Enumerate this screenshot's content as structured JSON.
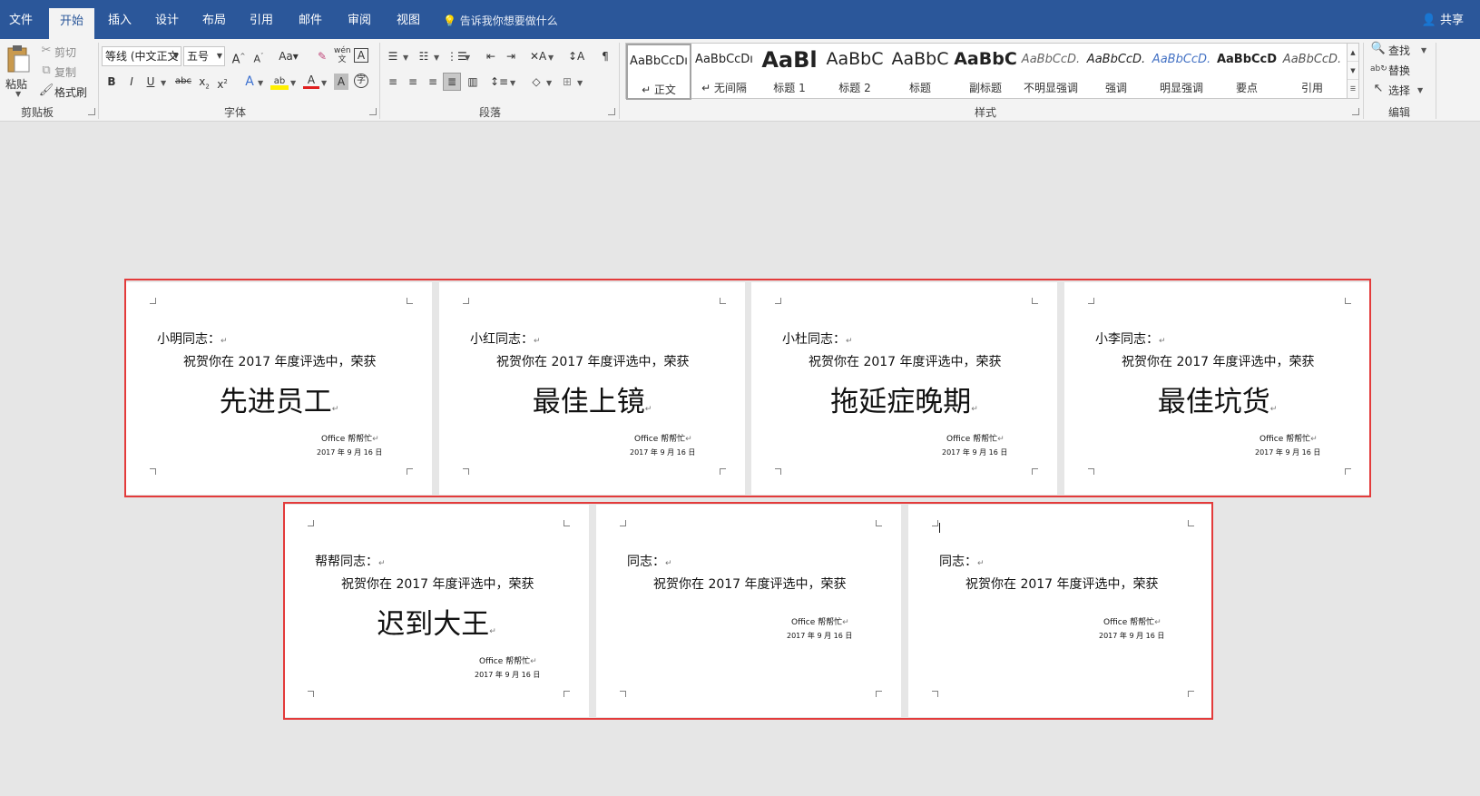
{
  "tabs": [
    {
      "label": "文件",
      "active": false
    },
    {
      "label": "开始",
      "active": true
    },
    {
      "label": "插入",
      "active": false
    },
    {
      "label": "设计",
      "active": false
    },
    {
      "label": "布局",
      "active": false
    },
    {
      "label": "引用",
      "active": false
    },
    {
      "label": "邮件",
      "active": false
    },
    {
      "label": "审阅",
      "active": false
    },
    {
      "label": "视图",
      "active": false
    }
  ],
  "tell_me": "告诉我你想要做什么",
  "share_label": "共享",
  "clipboard": {
    "paste": "粘贴",
    "cut": "剪切",
    "copy": "复制",
    "format_painter": "格式刷",
    "group": "剪贴板"
  },
  "font": {
    "name": "等线 (中文正文",
    "size": "五号",
    "group": "字体"
  },
  "paragraph": {
    "group": "段落"
  },
  "styles": {
    "group": "样式",
    "items": [
      {
        "preview": "AaBbCcDı",
        "name": "↵ 正文"
      },
      {
        "preview": "AaBbCcDı",
        "name": "↵ 无间隔"
      },
      {
        "preview": "AaBl",
        "name": "标题 1"
      },
      {
        "preview": "AaBbC",
        "name": "标题 2"
      },
      {
        "preview": "AaBbC",
        "name": "标题"
      },
      {
        "preview": "AaBbC",
        "name": "副标题"
      },
      {
        "preview": "AaBbCcD.",
        "name": "不明显强调"
      },
      {
        "preview": "AaBbCcD.",
        "name": "强调"
      },
      {
        "preview": "AaBbCcD.",
        "name": "明显强调"
      },
      {
        "preview": "AaBbCcD",
        "name": "要点"
      },
      {
        "preview": "AaBbCcD.",
        "name": "引用"
      }
    ]
  },
  "editing": {
    "find": "查找",
    "replace": "替换",
    "select": "选择",
    "group": "编辑"
  },
  "pages": [
    {
      "salutation": "小明同志：",
      "greeting": "祝贺你在 2017 年度评选中，荣获",
      "award": "先进员工",
      "sign": "Office 帮帮忙",
      "date": "2017 年 9 月 16 日"
    },
    {
      "salutation": "小红同志：",
      "greeting": "祝贺你在 2017 年度评选中，荣获",
      "award": "最佳上镜",
      "sign": "Office 帮帮忙",
      "date": "2017 年 9 月 16 日"
    },
    {
      "salutation": "小杜同志：",
      "greeting": "祝贺你在 2017 年度评选中，荣获",
      "award": "拖延症晚期",
      "sign": "Office 帮帮忙",
      "date": "2017 年 9 月 16 日"
    },
    {
      "salutation": "小李同志：",
      "greeting": "祝贺你在 2017 年度评选中，荣获",
      "award": "最佳坑货",
      "sign": "Office 帮帮忙",
      "date": "2017 年 9 月 16 日"
    },
    {
      "salutation": "帮帮同志：",
      "greeting": "祝贺你在 2017 年度评选中，荣获",
      "award": "迟到大王",
      "sign": "Office 帮帮忙",
      "date": "2017 年 9 月 16 日"
    },
    {
      "salutation": "同志：",
      "greeting": "祝贺你在 2017 年度评选中，荣获",
      "award": "",
      "sign": "Office 帮帮忙",
      "date": "2017 年 9 月 16 日"
    },
    {
      "salutation": "同志：",
      "greeting": "祝贺你在 2017 年度评选中，荣获",
      "award": "",
      "sign": "Office 帮帮忙",
      "date": "2017 年 9 月 16 日"
    }
  ],
  "highlight_color": "#e33b3b",
  "accent_color": "#2b579a"
}
